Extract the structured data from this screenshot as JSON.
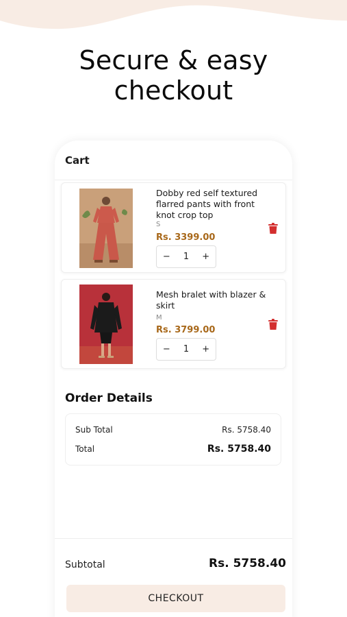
{
  "headline": {
    "line1": "Secure & easy",
    "line2": "checkout"
  },
  "cart": {
    "title": "Cart",
    "items": [
      {
        "name": "Dobby red self textured flarred pants with front knot crop top",
        "size": "S",
        "price": "Rs. 3399.00",
        "quantity": "1",
        "decrement": "−",
        "increment": "+"
      },
      {
        "name": "Mesh bralet with blazer & skirt",
        "size": "M",
        "price": "Rs. 3799.00",
        "quantity": "1",
        "decrement": "−",
        "increment": "+"
      }
    ]
  },
  "order_details": {
    "title": "Order Details",
    "sub_total_label": "Sub Total",
    "sub_total_value": "Rs. 5758.40",
    "total_label": "Total",
    "total_value": "Rs. 5758.40"
  },
  "footer": {
    "subtotal_label": "Subtotal",
    "subtotal_value": "Rs. 5758.40",
    "checkout_label": "CHECKOUT"
  },
  "colors": {
    "price": "#a8681a",
    "trash": "#d32f2f",
    "checkout_bg": "#f8ece4",
    "top_wave": "#f8ece4"
  }
}
